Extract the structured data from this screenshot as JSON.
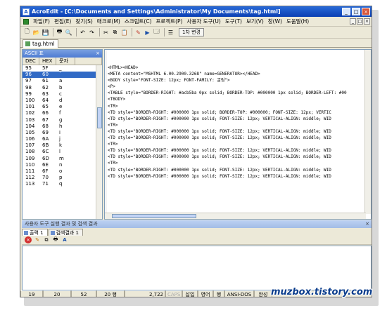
{
  "window": {
    "title": "AcroEdit - [C:\\Documents and Settings\\Administrator\\My Documents\\tag.html]"
  },
  "menu": [
    "파일(F)",
    "편집(E)",
    "찾기(S)",
    "매크로(M)",
    "스크립트(C)",
    "프로젝트(P)",
    "사용자 도구(U)",
    "도구(T)",
    "보기(V)",
    "창(W)",
    "도움말(H)"
  ],
  "toolbar": {
    "text_button": "1차 변경"
  },
  "file_tab": "tag.html",
  "ascii": {
    "title": "ASCII 표",
    "close": "×",
    "headers": [
      "DEC",
      "HEX",
      "문자"
    ],
    "rows": [
      [
        "95",
        "5F",
        "_"
      ],
      [
        "96",
        "60",
        "`"
      ],
      [
        "97",
        "61",
        "a"
      ],
      [
        "98",
        "62",
        "b"
      ],
      [
        "99",
        "63",
        "c"
      ],
      [
        "100",
        "64",
        "d"
      ],
      [
        "101",
        "65",
        "e"
      ],
      [
        "102",
        "66",
        "f"
      ],
      [
        "103",
        "67",
        "g"
      ],
      [
        "104",
        "68",
        "h"
      ],
      [
        "105",
        "69",
        "i"
      ],
      [
        "106",
        "6A",
        "j"
      ],
      [
        "107",
        "6B",
        "k"
      ],
      [
        "108",
        "6C",
        "l"
      ],
      [
        "109",
        "6D",
        "m"
      ],
      [
        "110",
        "6E",
        "n"
      ],
      [
        "111",
        "6F",
        "o"
      ],
      [
        "112",
        "70",
        "p"
      ],
      [
        "113",
        "71",
        "q"
      ]
    ],
    "selected_index": 1
  },
  "code_lines": [
    "<HTML><HEAD>",
    "<META content=\"MSHTML 6.00.2900.3268\" name=GENERATOR></HEAD>",
    "<BODY style=\"FONT-SIZE: 12px; FONT-FAMILY: 굴림\">",
    "<P>",
    "<TABLE style=\"BORDER-RIGHT: #acb5ba 0px solid; BORDER-TOP: #000000 1px solid; BORDER-LEFT: #00",
    "<TBODY>",
    "<TR>",
    "<TD style=\"BORDER-RIGHT: #000000 1px solid; BORDER-TOP: #000000; FONT-SIZE: 12px; VERTIC",
    "<TD style=\"BORDER-RIGHT: #000000 1px solid; FONT-SIZE: 12px; VERTICAL-ALIGN: middle; WID",
    "<TR>",
    "<TD style=\"BORDER-RIGHT: #000000 1px solid; FONT-SIZE: 12px; VERTICAL-ALIGN: middle; WID",
    "<TD style=\"BORDER-RIGHT: #000000 1px solid; FONT-SIZE: 12px; VERTICAL-ALIGN: middle; WID",
    "<TR>",
    "<TD style=\"BORDER-RIGHT: #000000 1px solid; FONT-SIZE: 12px; VERTICAL-ALIGN: middle; WID",
    "<TD style=\"BORDER-RIGHT: #000000 1px solid; FONT-SIZE: 12px; VERTICAL-ALIGN: middle; WID",
    "<TR>",
    "<TD style=\"BORDER-RIGHT: #000000 1px solid; FONT-SIZE: 12px; VERTICAL-ALIGN: middle; WID",
    "<TD style=\"BORDER-RIGHT: #000000 1px solid; FONT-SIZE: 12px; VERTICAL-ALIGN: middle; WID"
  ],
  "output": {
    "title": "사용자 도구 실행 결과 및 검색 결과",
    "close": "×",
    "tabs": [
      "출력 1",
      "검색결과 1"
    ]
  },
  "status": [
    "19",
    "20",
    "52",
    "20 행",
    "2,722",
    "CAPS",
    "삽입",
    "영어",
    "행",
    "ANSI-DOS",
    "완성"
  ],
  "watermark": "muzbox.tistory.com"
}
